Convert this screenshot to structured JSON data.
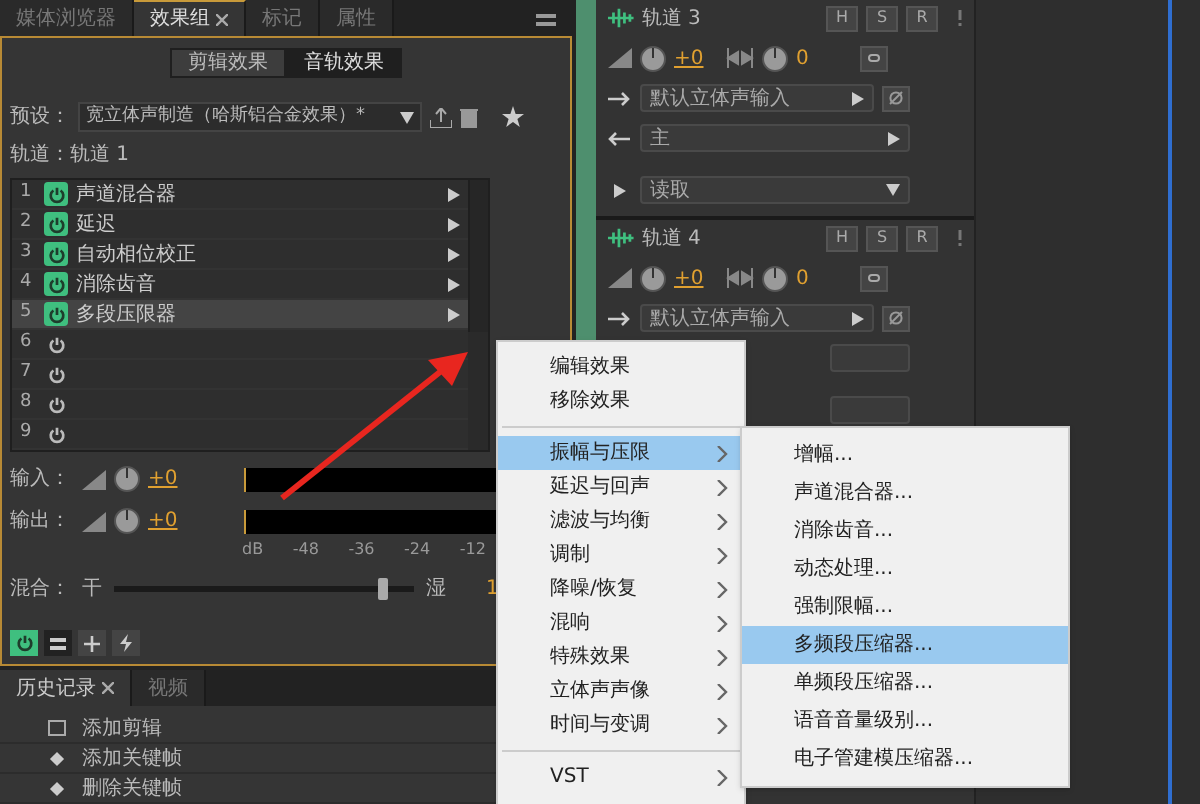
{
  "panel_tabs": [
    {
      "label": "媒体浏览器",
      "selected": false,
      "closable": false
    },
    {
      "label": "效果组",
      "selected": true,
      "closable": true
    },
    {
      "label": "标记",
      "selected": false,
      "closable": false
    },
    {
      "label": "属性",
      "selected": false,
      "closable": false
    }
  ],
  "effect_mode_buttons": [
    {
      "label": "剪辑效果",
      "selected": false
    },
    {
      "label": "音轨效果",
      "selected": true
    }
  ],
  "preset": {
    "label": "预设：",
    "value": "宽立体声制造（哈斯铝合金效果）*"
  },
  "track_label": "轨道：轨道 1",
  "effects": [
    {
      "number": "1",
      "name": "声道混合器",
      "on": true,
      "selected": false
    },
    {
      "number": "2",
      "name": "延迟",
      "on": true,
      "selected": false
    },
    {
      "number": "3",
      "name": "自动相位校正",
      "on": true,
      "selected": false
    },
    {
      "number": "4",
      "name": "消除齿音",
      "on": true,
      "selected": false
    },
    {
      "number": "5",
      "name": "多段压限器",
      "on": true,
      "selected": true
    },
    {
      "number": "6",
      "on": false,
      "selected": false
    },
    {
      "number": "7",
      "on": false,
      "selected": false
    },
    {
      "number": "8",
      "on": false,
      "selected": false
    },
    {
      "number": "9",
      "on": false,
      "selected": false
    }
  ],
  "io": [
    {
      "label": "输入：",
      "value": "+0"
    },
    {
      "label": "输出：",
      "value": "+0"
    }
  ],
  "meter_scale": [
    "dB",
    "-48",
    "-36",
    "-24",
    "-12"
  ],
  "mix": {
    "label": "混合：",
    "dry": "干",
    "wet": "湿",
    "level": 0.9,
    "reading": "1"
  },
  "history_tabs": [
    {
      "label": "历史记录",
      "selected": true,
      "closable": true
    },
    {
      "label": "视频",
      "selected": false,
      "closable": false
    }
  ],
  "history_items": [
    {
      "label": "添加剪辑",
      "kind": "clip"
    },
    {
      "label": "添加关键帧",
      "kind": "keyframe"
    },
    {
      "label": "删除关键帧",
      "kind": "keyframe"
    }
  ],
  "tracks": [
    {
      "name": "轨道 3",
      "buttons": [
        "H",
        "S",
        "R"
      ],
      "volume": "+0",
      "pan": "0",
      "input": "默认立体声输入",
      "output": "主",
      "automation": "读取"
    },
    {
      "name": "轨道 4",
      "buttons": [
        "H",
        "S",
        "R"
      ],
      "volume": "+0",
      "pan": "0",
      "input": "默认立体声输入"
    }
  ],
  "context_menu": [
    {
      "kind": "item",
      "label": "编辑效果",
      "selected": false
    },
    {
      "kind": "item",
      "label": "移除效果",
      "selected": false
    },
    {
      "kind": "separator"
    },
    {
      "kind": "submenu",
      "label": "振幅与压限",
      "selected": true
    },
    {
      "kind": "submenu",
      "label": "延迟与回声",
      "selected": false
    },
    {
      "kind": "submenu",
      "label": "滤波与均衡",
      "selected": false
    },
    {
      "kind": "submenu",
      "label": "调制",
      "selected": false
    },
    {
      "kind": "submenu",
      "label": "降噪/恢复",
      "selected": false
    },
    {
      "kind": "submenu",
      "label": "混响",
      "selected": false
    },
    {
      "kind": "submenu",
      "label": "特殊效果",
      "selected": false
    },
    {
      "kind": "submenu",
      "label": "立体声声像",
      "selected": false
    },
    {
      "kind": "submenu",
      "label": "时间与变调",
      "selected": false
    },
    {
      "kind": "separator"
    },
    {
      "kind": "submenu",
      "label": "VST",
      "selected": false
    }
  ],
  "submenu": [
    {
      "label": "增幅...",
      "selected": false
    },
    {
      "label": "声道混合器...",
      "selected": false
    },
    {
      "label": "消除齿音...",
      "selected": false
    },
    {
      "label": "动态处理...",
      "selected": false
    },
    {
      "label": "强制限幅...",
      "selected": false
    },
    {
      "label": "多频段压缩器...",
      "selected": true
    },
    {
      "label": "单频段压缩器...",
      "selected": false
    },
    {
      "label": "语音音量级别...",
      "selected": false
    },
    {
      "label": "电子管建模压缩器...",
      "selected": false
    }
  ]
}
